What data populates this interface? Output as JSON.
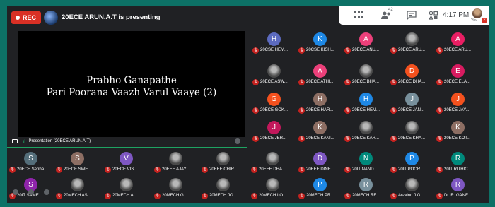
{
  "recording_label": "REC",
  "presenter_text": "20ECE ARUN.A.T is presenting",
  "topbar": {
    "participants_count": "42",
    "time": "4:17 PM",
    "you_label": "You"
  },
  "slide": {
    "line1": "Prabho Ganapathe",
    "line2": "Pari Poorana Vaazh Varul Vaaye (2)"
  },
  "presentation_label": "Presentation (20ECE ARUN.A.T)",
  "tiles": [
    {
      "initial": "H",
      "color": "#5c6bc0",
      "name": "20CSE HEM..."
    },
    {
      "initial": "K",
      "color": "#1e88e5",
      "name": "20CSE KISH..."
    },
    {
      "initial": "A",
      "color": "#ec407a",
      "name": "20ECE ANU..."
    },
    {
      "initial": "",
      "color": "img",
      "name": "20ECE ARU..."
    },
    {
      "initial": "A",
      "color": "#e91e63",
      "name": "20ECE ARU..."
    },
    {
      "initial": "",
      "color": "img",
      "name": "20ECE ASW..."
    },
    {
      "initial": "A",
      "color": "#ec407a",
      "name": "20ECE ATHI..."
    },
    {
      "initial": "",
      "color": "img",
      "name": "20ECE BHA..."
    },
    {
      "initial": "D",
      "color": "#f4511e",
      "name": "20ECE DHA..."
    },
    {
      "initial": "E",
      "color": "#d81b60",
      "name": "20ECE ELA..."
    },
    {
      "initial": "G",
      "color": "#f4511e",
      "name": "20ECE GOK..."
    },
    {
      "initial": "H",
      "color": "#8d6e63",
      "name": "20ECE HAR..."
    },
    {
      "initial": "H",
      "color": "#1e88e5",
      "name": "20ECE HEM..."
    },
    {
      "initial": "J",
      "color": "#78909c",
      "name": "20ECE JAN..."
    },
    {
      "initial": "J",
      "color": "#f4511e",
      "name": "20ECE JAY..."
    },
    {
      "initial": "J",
      "color": "#c2185b",
      "name": "20ECE JER..."
    },
    {
      "initial": "K",
      "color": "#8d6e63",
      "name": "20ECE KANI..."
    },
    {
      "initial": "",
      "color": "img",
      "name": "20ECE KAR..."
    },
    {
      "initial": "",
      "color": "img",
      "name": "20ECE KHA..."
    },
    {
      "initial": "K",
      "color": "#8d6e63",
      "name": "20ECE KOT..."
    },
    {
      "initial": "S",
      "color": "#546e7a",
      "name": "20ECE Senba"
    },
    {
      "initial": "S",
      "color": "#8d6e63",
      "name": "20ECE SWE..."
    },
    {
      "initial": "V",
      "color": "#7e57c2",
      "name": "20ECE VIS..."
    },
    {
      "initial": "",
      "color": "img",
      "name": "20EEE AJAY..."
    },
    {
      "initial": "",
      "color": "img",
      "name": "20EEE CHIR..."
    },
    {
      "initial": "",
      "color": "img",
      "name": "20EEE DHA..."
    },
    {
      "initial": "D",
      "color": "#7e57c2",
      "name": "20EEE DINE..."
    },
    {
      "initial": "N",
      "color": "#00897b",
      "name": "20IT NAND..."
    },
    {
      "initial": "P",
      "color": "#1e88e5",
      "name": "20IT POOR..."
    },
    {
      "initial": "R",
      "color": "#00897b",
      "name": "20IT RITHIC..."
    },
    {
      "initial": "S",
      "color": "#8e24aa",
      "name": "20IT SAME..."
    },
    {
      "initial": "",
      "color": "img",
      "name": "20MECH AS..."
    },
    {
      "initial": "",
      "color": "img",
      "name": "20MECH A..."
    },
    {
      "initial": "",
      "color": "img",
      "name": "20MECH G..."
    },
    {
      "initial": "",
      "color": "img",
      "name": "20MECH JO..."
    },
    {
      "initial": "",
      "color": "img",
      "name": "20MECH LO..."
    },
    {
      "initial": "P",
      "color": "#1e88e5",
      "name": "20MECH PR..."
    },
    {
      "initial": "R",
      "color": "#78909c",
      "name": "20MECH RE..."
    },
    {
      "initial": "",
      "color": "img",
      "name": "Aravind J.G"
    },
    {
      "initial": "R",
      "color": "#7e57c2",
      "name": "Dr. R. GANE..."
    }
  ]
}
